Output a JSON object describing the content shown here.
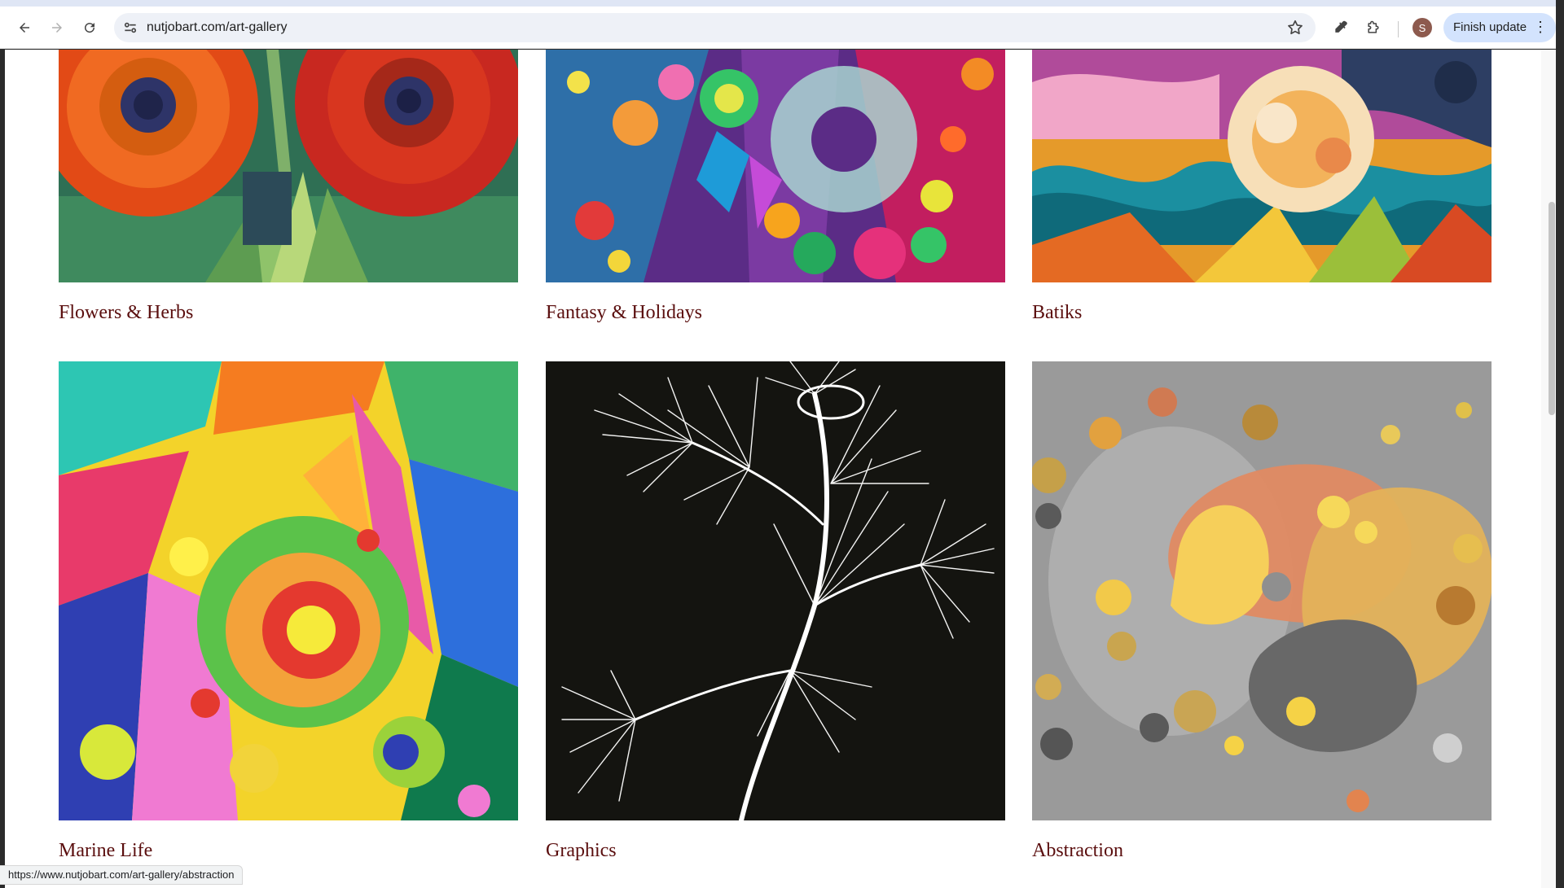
{
  "browser": {
    "url": "nutjobart.com/art-gallery",
    "update_button_label": "Finish update",
    "avatar_letter": "S",
    "status_url": "https://www.nutjobart.com/art-gallery/abstraction"
  },
  "gallery": {
    "row1": [
      "Flowers & Herbs",
      "Fantasy & Holidays",
      "Batiks"
    ],
    "row2": [
      "Marine Life",
      "Graphics",
      "Abstraction"
    ]
  },
  "colors": {
    "caption": "#5a0e0e",
    "update_button_bg": "#d3e3fd"
  }
}
